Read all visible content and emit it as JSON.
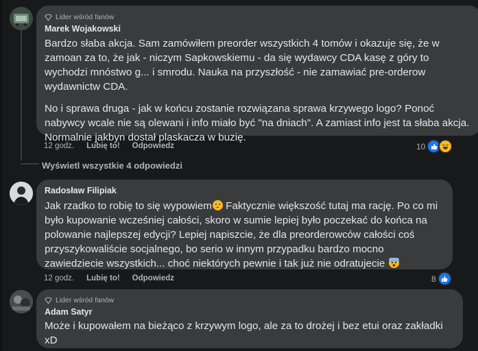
{
  "comments": [
    {
      "badge": "Lider wśród fanów",
      "author": "Marek Wojakowski",
      "paragraphs": [
        "Bardzo słaba akcja. Sam zamówiłem preorder wszystkich 4 tomów i okazuje się, że w zamoan za to, że jak - niczym Sapkowskiemu - da się wydawcy CDA kasę z góry to wychodzi mnóstwo g... i smrodu. Nauka na przyszłość - nie zamawiać pre-orderow wydawnictw CDA.",
        "No i sprawa druga - jak w końcu zostanie rozwiązana sprawa krzywego logo? Ponoć nabywcy wcale nie są olewani i info miało być \"na dniach\". A zamiast info jest ta słaba akcja. Normalnie jakbyn dostał plaskacza w buzię."
      ],
      "time": "12 godz.",
      "like_label": "Lubię to!",
      "reply_label": "Odpowiedz",
      "reaction_count": "10"
    },
    {
      "author": "Radosław Filipiak",
      "text_part1": "Jak rzadko to robię to się wypowiem",
      "text_part2": " Faktycznie większość tutaj ma rację. Po co mi było kupowanie wcześniej całości, skoro w sumie lepiej było poczekać do końca na polowanie najlepszej edycji? Lepiej napiszcie, że dla preorderowców całości coś przyszykowaliście socjalnego, bo serio w innym przypadku bardzo mocno zawiedziecie wszystkich... choć niektórych pewnie i tak już nie odratujecie ",
      "time": "12 godz.",
      "like_label": "Lubię to!",
      "reply_label": "Odpowiedz",
      "reaction_count": "8"
    },
    {
      "badge": "Lider wśród fanów",
      "author": "Adam Satyr",
      "text": "Może i kupowałem na bieżąco z krzywym logo, ale za to drożej i bez etui oraz zakładki xD"
    }
  ],
  "view_replies_label": "Wyświetl wszystkie 4 odpowiedzi",
  "icons": {
    "badge": "diamond-icon",
    "like": "thumbs-up-icon",
    "haha": "laughing-face-icon",
    "thinking": "thinking-face-icon",
    "scared": "fearful-face-icon"
  },
  "colors": {
    "background": "#18191a",
    "bubble": "#3a3b3c",
    "like_blue": "#1877f2",
    "haha_yellow": "#f7b928"
  }
}
